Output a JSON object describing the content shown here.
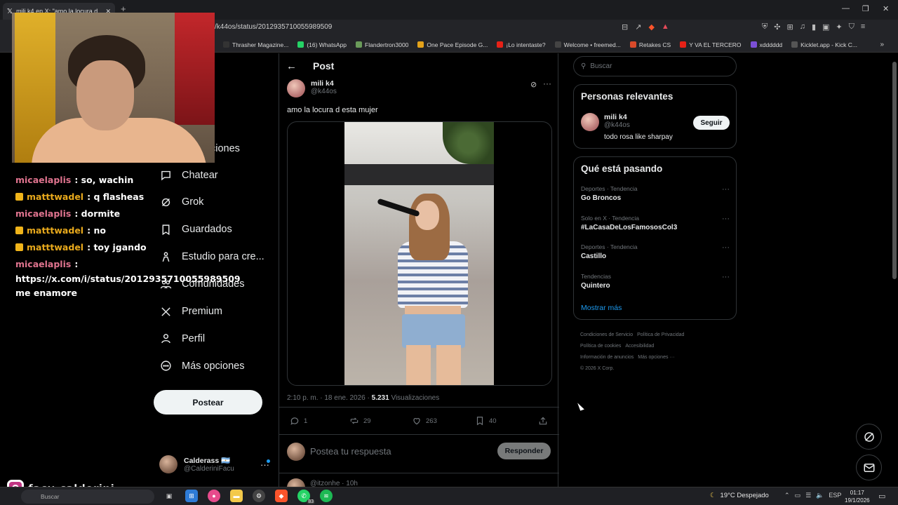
{
  "browser": {
    "tab_title": "mili k4 en X: \"amo la locura d",
    "url": "/k44os/status/2012935710055989509",
    "bookmarks": [
      {
        "label": "Thrasher Magazine...",
        "color": "#333333"
      },
      {
        "label": "(16) WhatsApp",
        "color": "#25d366"
      },
      {
        "label": "Flandertron3000",
        "color": "#6a9b5a"
      },
      {
        "label": "One Pace Episode G...",
        "color": "#e3a21a"
      },
      {
        "label": "¡Lo intentaste?",
        "color": "#e62117"
      },
      {
        "label": "Welcome • freemed...",
        "color": "#444444"
      },
      {
        "label": "Retakes CS",
        "color": "#d94a2a"
      },
      {
        "label": "Y VA EL TERCERO",
        "color": "#e62117"
      },
      {
        "label": "xdddddd",
        "color": "#7b4fd6"
      },
      {
        "label": "Kicklet.app - Kick C...",
        "color": "#555555"
      }
    ]
  },
  "chat": {
    "messages": [
      {
        "user": "micaelaplis",
        "text": ": so, wachin",
        "badge": false
      },
      {
        "user": "matttwadel",
        "text": ": q flasheas",
        "badge": true
      },
      {
        "user": "micaelaplis",
        "text": ": dormite",
        "badge": false
      },
      {
        "user": "matttwadel",
        "text": ": no",
        "badge": true
      },
      {
        "user": "matttwadel",
        "text": ": toy jgando",
        "badge": true
      }
    ],
    "last_user": "micaelaplis",
    "last_text": "https://x.com/i/status/2012935710055989509 me enamore"
  },
  "nav": {
    "partial_label": "ciones",
    "items": [
      {
        "label": "Chatear",
        "icon": "chat-icon"
      },
      {
        "label": "Grok",
        "icon": "grok-icon"
      },
      {
        "label": "Guardados",
        "icon": "bookmark-icon"
      },
      {
        "label": "Estudio para cre...",
        "icon": "creator-studio-icon"
      },
      {
        "label": "Comunidades",
        "icon": "communities-icon"
      },
      {
        "label": "Premium",
        "icon": "x-logo-icon"
      },
      {
        "label": "Perfil",
        "icon": "profile-icon"
      },
      {
        "label": "Más opciones",
        "icon": "more-options-icon"
      }
    ],
    "post_button": "Postear",
    "account": {
      "name": "Calderass 🇦🇷",
      "handle": "@CalderiniFacu"
    }
  },
  "post": {
    "header": "Post",
    "author_name": "mili k4",
    "author_handle": "@k44os",
    "text": "amo la locura d esta mujer",
    "time": "2:10 p. m. · 18 ene. 2026 · ",
    "views": "5.231",
    "views_label": " Visualizaciones",
    "replies": "1",
    "reposts": "29",
    "likes": "263",
    "bookmarks": "40",
    "reply_placeholder": "Postea tu respuesta",
    "reply_button": "Responder",
    "next_reply_user": "@itzonhe · 10h"
  },
  "right": {
    "search_placeholder": "Buscar",
    "relevant_title": "Personas relevantes",
    "relevant_user": {
      "name": "mili k4",
      "handle": "@k44os",
      "bio": "todo rosa like sharpay",
      "follow": "Seguir"
    },
    "trends_title": "Qué está pasando",
    "trends": [
      {
        "category": "Deportes · Tendencia",
        "name": "Go Broncos"
      },
      {
        "category": "Solo en X · Tendencia",
        "name": "#LaCasaDeLosFamososCol3"
      },
      {
        "category": "Deportes · Tendencia",
        "name": "Castillo"
      },
      {
        "category": "Tendencias",
        "name": "Quintero"
      }
    ],
    "show_more": "Mostrar más",
    "footer": [
      "Condiciones de Servicio",
      "Política de Privacidad",
      "Política de cookies",
      "Accesibilidad",
      "Información de anuncios",
      "Más opciones ···",
      "© 2026 X Corp."
    ]
  },
  "overlay": {
    "streamer": "facu.calderini"
  },
  "taskbar": {
    "search": "Buscar",
    "whatsapp_badge": "83",
    "weather": "19°C  Despejado",
    "lang": "ESP",
    "time": "01:17",
    "date": "19/1/2026"
  }
}
